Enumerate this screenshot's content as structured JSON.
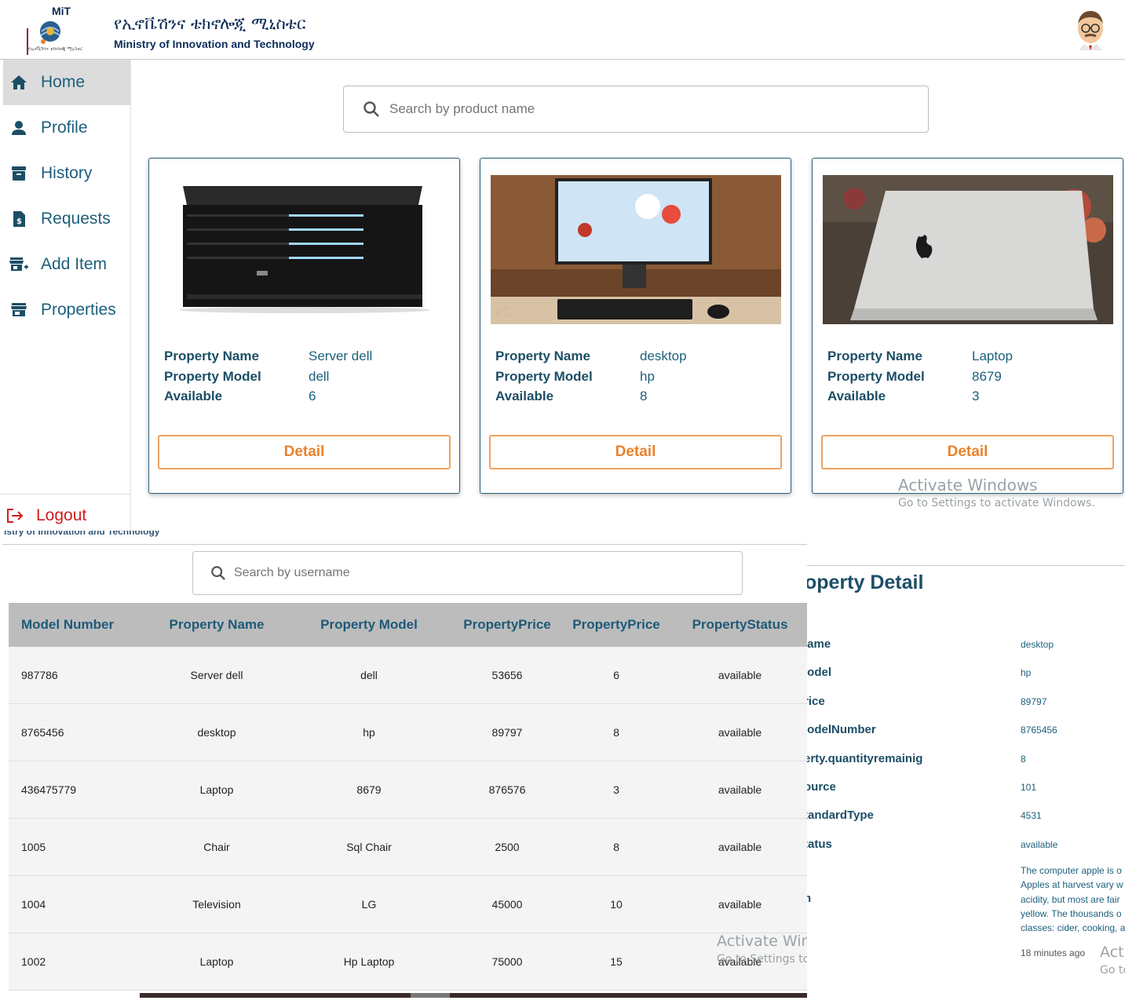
{
  "header": {
    "logo_text": "MiT",
    "logo_subtitle": "የኢኖቬሽንና ቴክኖሎጂ ሚኒስቴር",
    "title_amharic": "የኢኖቬሽንና ቴክኖሎጂ ሚኒስቴር",
    "title_english": "Ministry of Innovation and Technology"
  },
  "sidebar": {
    "items": [
      {
        "label": "Home",
        "icon": "home-icon",
        "active": true
      },
      {
        "label": "Profile",
        "icon": "person-icon"
      },
      {
        "label": "History",
        "icon": "archive-icon"
      },
      {
        "label": "Requests",
        "icon": "request-icon"
      },
      {
        "label": "Add Item",
        "icon": "add-store-icon"
      },
      {
        "label": "Properties",
        "icon": "store-icon"
      }
    ],
    "logout_label": "Logout"
  },
  "search": {
    "placeholder": "Search by product name"
  },
  "cards": [
    {
      "name_label": "Property Name",
      "name": "Server dell",
      "model_label": "Property Model",
      "model": "dell",
      "available_label": "Available",
      "available": "6",
      "button": "Detail"
    },
    {
      "name_label": "Property Name",
      "name": "desktop",
      "model_label": "Property Model",
      "model": "hp",
      "available_label": "Available",
      "available": "8",
      "button": "Detail"
    },
    {
      "name_label": "Property Name",
      "name": "Laptop",
      "model_label": "Property Model",
      "model": "8679",
      "available_label": "Available",
      "available": "3",
      "button": "Detail"
    }
  ],
  "watermark": {
    "title": "Activate Windows",
    "subtitle": "Go to Settings to activate Windows.",
    "title_cut": "Activate Win",
    "subtitle_cut": "Go to Settings to",
    "title_cut2": "Acti",
    "subtitle_cut2": "Go to"
  },
  "history": {
    "cut_header_text": "istry of Innovation and Technology",
    "search_placeholder": "Search by username",
    "columns": [
      "Model Number",
      "Property Name",
      "Property Model",
      "PropertyPrice",
      "PropertyPrice",
      "PropertyStatus"
    ],
    "rows": [
      [
        "987786",
        "Server dell",
        "dell",
        "53656",
        "6",
        "available"
      ],
      [
        "8765456",
        "desktop",
        "hp",
        "89797",
        "8",
        "available"
      ],
      [
        "436475779",
        "Laptop",
        "8679",
        "876576",
        "3",
        "available"
      ],
      [
        "1005",
        "Chair",
        "Sql Chair",
        "2500",
        "8",
        "available"
      ],
      [
        "1004",
        "Television",
        "LG",
        "45000",
        "10",
        "available"
      ],
      [
        "1002",
        "Laptop",
        "Hp Laptop",
        "75000",
        "15",
        "available"
      ]
    ]
  },
  "detail": {
    "title": "operty Detail",
    "fields": [
      {
        "label": "lame",
        "value": "desktop"
      },
      {
        "label": "lodel",
        "value": "hp"
      },
      {
        "label": "rice",
        "value": "89797"
      },
      {
        "label": "lodelNumber",
        "value": "8765456"
      },
      {
        "label": "erty.quantityremainig",
        "value": "8"
      },
      {
        "label": "ource",
        "value": "101"
      },
      {
        "label": "tandardType",
        "value": "4531"
      },
      {
        "label": "tatus",
        "value": "available"
      }
    ],
    "description_label": "n",
    "description_lines": [
      "The computer apple is o",
      "Apples at harvest vary w",
      "acidity, but most are fair",
      "yellow. The thousands o",
      "classes: cider, cooking, a"
    ],
    "time": "18 minutes ago"
  }
}
